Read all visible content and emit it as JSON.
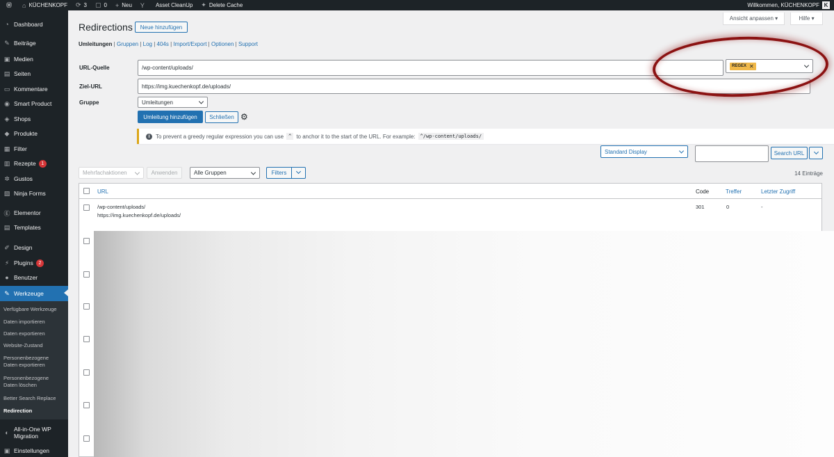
{
  "adminbar": {
    "site_name": "KÜCHENKOPF",
    "updates_count": "3",
    "comments_count": "0",
    "new_label": "Neu",
    "asset_cleanup": "Asset CleanUp",
    "delete_cache": "Delete Cache",
    "welcome": "Willkommen, KÜCHENKOPF",
    "avatar_letter": "K"
  },
  "sidebar": {
    "items": [
      {
        "label": "Dashboard",
        "icon": "dashboard-icon"
      },
      {
        "label": "Beiträge",
        "icon": "pin-icon"
      },
      {
        "label": "Medien",
        "icon": "media-icon"
      },
      {
        "label": "Seiten",
        "icon": "page-icon"
      },
      {
        "label": "Kommentare",
        "icon": "comment-icon"
      },
      {
        "label": "Smart Product",
        "icon": "eye-icon"
      },
      {
        "label": "Shops",
        "icon": "cart-icon"
      },
      {
        "label": "Produkte",
        "icon": "box-icon"
      },
      {
        "label": "Filter",
        "icon": "filter-icon"
      },
      {
        "label": "Rezepte",
        "icon": "recipe-icon",
        "badge": "1"
      },
      {
        "label": "Gustos",
        "icon": "gear-icon"
      },
      {
        "label": "Ninja Forms",
        "icon": "form-icon"
      },
      {
        "label": "Elementor",
        "icon": "elementor-icon"
      },
      {
        "label": "Templates",
        "icon": "folder-icon"
      },
      {
        "label": "Design",
        "icon": "brush-icon"
      },
      {
        "label": "Plugins",
        "icon": "plugin-icon",
        "badge": "2"
      },
      {
        "label": "Benutzer",
        "icon": "user-icon"
      },
      {
        "label": "Werkzeuge",
        "icon": "wrench-icon"
      },
      {
        "label": "All-in-One WP Migration",
        "icon": "migration-icon"
      },
      {
        "label": "Einstellungen",
        "icon": "settings-icon"
      }
    ],
    "submenu": [
      "Verfügbare Werkzeuge",
      "Daten importieren",
      "Daten exportieren",
      "Website-Zustand",
      "Personenbezogene Daten exportieren",
      "Personenbezogene Daten löschen",
      "Better Search Replace",
      "Redirection"
    ]
  },
  "screen_options": "Ansicht anpassen ▾",
  "help": "Hilfe ▾",
  "page_title": "Redirections",
  "add_new_button": "Neue hinzufügen",
  "subnav": {
    "current": "Umleitungen",
    "links": [
      "Gruppen",
      "Log",
      "404s",
      "Import/Export",
      "Optionen",
      "Support"
    ]
  },
  "form": {
    "source_label": "URL-Quelle",
    "source_value": "/wp-content/uploads/",
    "regex_tag": "REGEX",
    "target_label": "Ziel-URL",
    "target_value": "https://img.kuechenkopf.de/uploads/",
    "group_label": "Gruppe",
    "group_value": "Umleitungen",
    "add_button": "Umleitung hinzufügen",
    "close_button": "Schließen"
  },
  "notice": {
    "text_before": "To prevent a greedy regular expression you can use",
    "caret_code": "^",
    "text_after": "to anchor it to the start of the URL. For example:",
    "example_code": "^/wp-content/uploads/"
  },
  "display_select": "Standard Display",
  "search_placeholder": "",
  "search_button": "Search URL",
  "bulk_actions": "Mehrfachaktionen",
  "apply_button": "Anwenden",
  "groups_filter": "Alle Gruppen",
  "filters_button": "Filters",
  "entries_count": "14 Einträge",
  "table": {
    "columns": [
      "URL",
      "Code",
      "Treffer",
      "Letzter Zugriff"
    ],
    "rows": [
      {
        "url": "/wp-content/uploads/",
        "target": "https://img.kuechenkopf.de/uploads/",
        "code": "301",
        "hits": "0",
        "last_access": "-"
      }
    ]
  },
  "colors": {
    "admin_dark": "#1d2327",
    "accent": "#2271b1",
    "badge_red": "#d63638",
    "regex_tag": "#f0b849",
    "annotation_red": "#8b1212"
  }
}
